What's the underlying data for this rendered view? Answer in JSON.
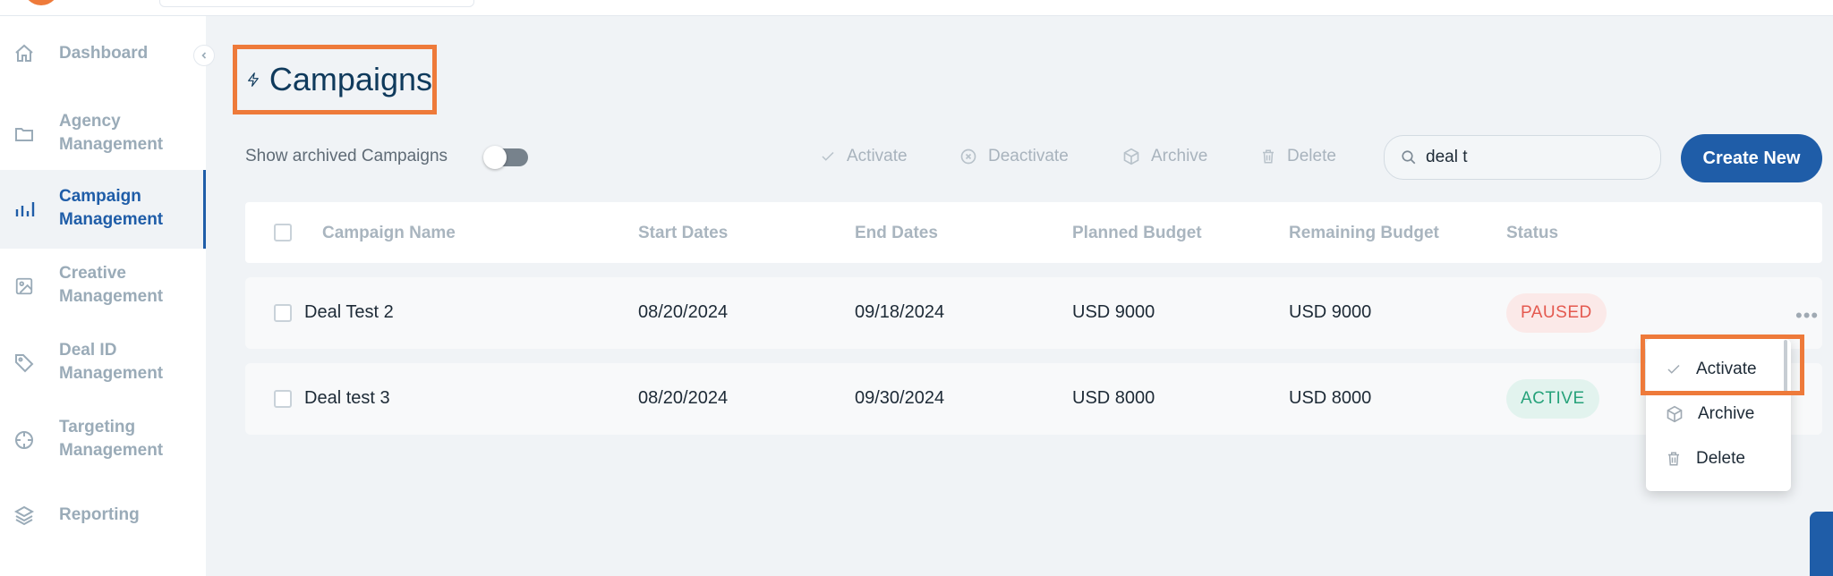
{
  "sidebar": {
    "items": [
      {
        "label": "Dashboard",
        "icon": "home-icon"
      },
      {
        "label": "Agency Management",
        "icon": "folder-icon"
      },
      {
        "label": "Campaign Management",
        "icon": "bar-chart-icon",
        "active": true
      },
      {
        "label": "Creative Management",
        "icon": "image-icon"
      },
      {
        "label": "Deal ID Management",
        "icon": "tag-icon"
      },
      {
        "label": "Targeting Management",
        "icon": "crosshair-icon"
      },
      {
        "label": "Reporting",
        "icon": "layers-icon"
      }
    ]
  },
  "page": {
    "title": "Campaigns"
  },
  "toolbar": {
    "show_archived_label": "Show archived Campaigns",
    "activate_label": "Activate",
    "deactivate_label": "Deactivate",
    "archive_label": "Archive",
    "delete_label": "Delete",
    "search_value": "deal t",
    "create_label": "Create New"
  },
  "table": {
    "columns": [
      "Campaign Name",
      "Start Dates",
      "End Dates",
      "Planned Budget",
      "Remaining Budget",
      "Status"
    ],
    "rows": [
      {
        "name": "Deal Test 2",
        "start": "08/20/2024",
        "end": "09/18/2024",
        "planned": "USD 9000",
        "remaining": "USD 9000",
        "status": "PAUSED",
        "more": "•••"
      },
      {
        "name": "Deal test 3",
        "start": "08/20/2024",
        "end": "09/30/2024",
        "planned": "USD 8000",
        "remaining": "USD 8000",
        "status": "ACTIVE"
      }
    ]
  },
  "row_menu": {
    "items": [
      "Activate",
      "Archive",
      "Delete"
    ]
  },
  "colors": {
    "primary": "#1f5da8",
    "highlight": "#ee7a3a",
    "paused": "#e4594f",
    "active": "#26a27a"
  }
}
